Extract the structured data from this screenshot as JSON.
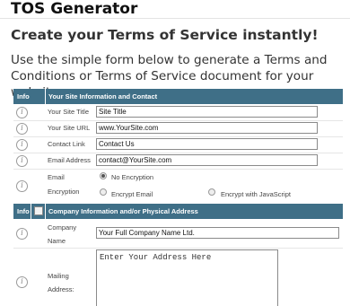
{
  "app": {
    "title": "TOS Generator"
  },
  "page": {
    "heading": "Create your Terms of Service instantly!",
    "intro": "Use the simple form below to generate a Terms and Conditions or Terms of Service document for your website."
  },
  "section1": {
    "info_col": "Info",
    "title": "Your Site Information and Contact",
    "rows": [
      {
        "label": "Your Site Title",
        "value": "Site Title"
      },
      {
        "label": "Your Site URL",
        "value": "www.YourSite.com"
      },
      {
        "label": "Contact Link",
        "value": "Contact Us"
      },
      {
        "label": "Email Address",
        "value": "contact@YourSite.com"
      }
    ],
    "encryption": {
      "label_line1": "Email",
      "label_line2": "Encryption",
      "options": [
        "No Encryption",
        "Encrypt Email",
        "Encrypt with JavaScript"
      ],
      "selected": "No Encryption"
    }
  },
  "section2": {
    "info_col": "Info",
    "title": "Company Information and/or Physical Address",
    "company": {
      "label_line1": "Company",
      "label_line2": "Name",
      "value": "Your Full Company Name Ltd."
    },
    "address": {
      "label_line1": "Mailing",
      "label_line2": "Address:",
      "value": "Enter Your Address Here"
    }
  },
  "icons": {
    "info": "info-icon",
    "radio": "radio-icon"
  }
}
